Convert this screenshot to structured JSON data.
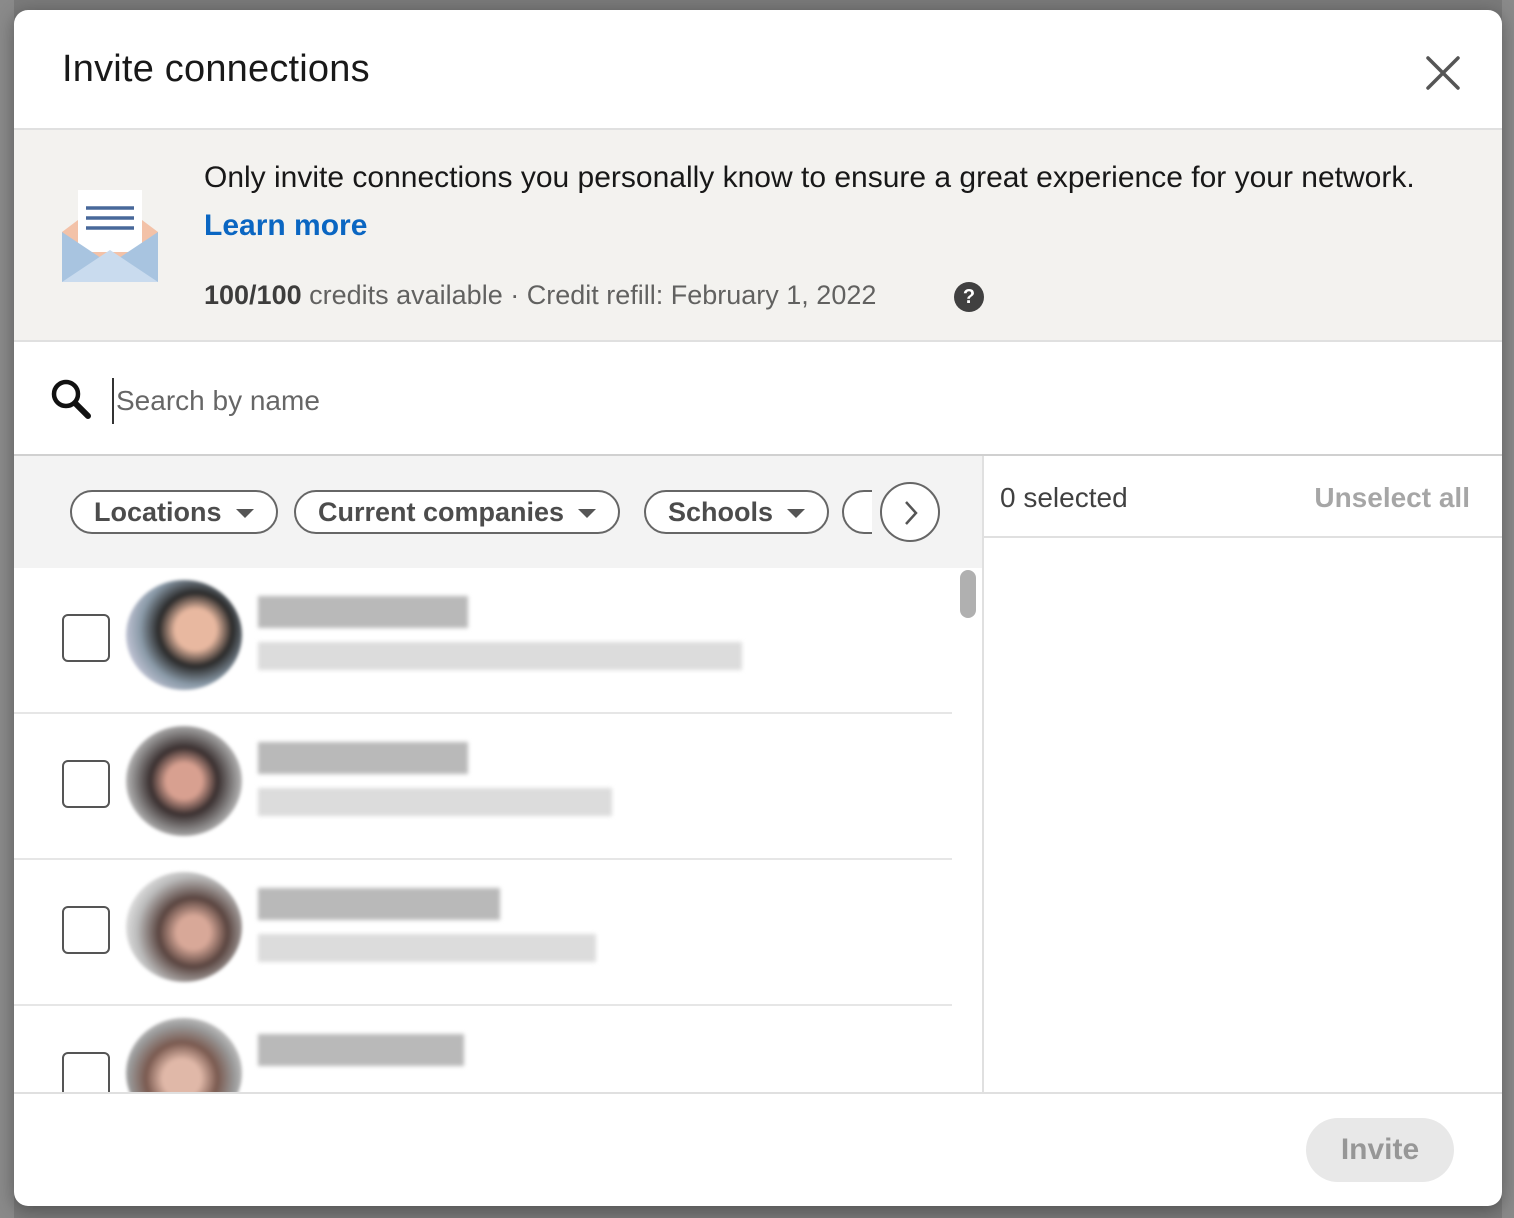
{
  "modal": {
    "title": "Invite connections",
    "close_label": "Dismiss"
  },
  "notice": {
    "text": "Only invite connections you personally know to ensure a great experience for your network.",
    "learn_more": "Learn more",
    "credits_bold": "100/100",
    "credits_rest": " credits available · Credit refill: February 1, 2022",
    "help_glyph": "?"
  },
  "search": {
    "placeholder": "Search by name",
    "value": ""
  },
  "filters": [
    {
      "label": "Locations"
    },
    {
      "label": "Current companies"
    },
    {
      "label": "Schools"
    }
  ],
  "selection": {
    "count_label": "0 selected",
    "unselect_all": "Unselect all"
  },
  "footer": {
    "invite_label": "Invite"
  },
  "icons": {
    "close": "close-icon",
    "envelope": "envelope-icon",
    "help": "help-icon",
    "search": "search-icon",
    "caret": "caret-down-icon",
    "next": "chevron-right-icon"
  },
  "colors": {
    "accent": "#0a66c2",
    "notice_bg": "#f3f2ef",
    "disabled_text": "#a6a6a6",
    "disabled_bg": "#e8e8e8"
  }
}
